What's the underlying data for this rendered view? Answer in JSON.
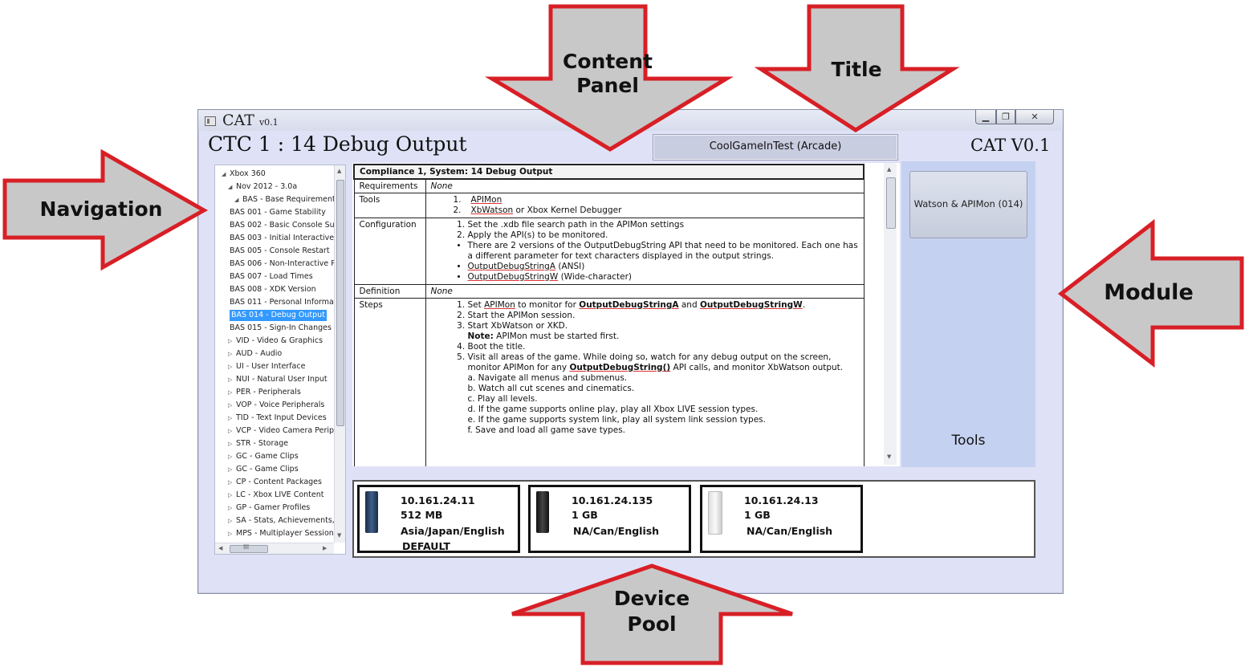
{
  "window": {
    "app_name": "CAT",
    "app_version": "v0.1",
    "page_title": "CTC 1 : 14 Debug Output",
    "game_title": "CoolGameInTest (Arcade)",
    "brand": "CAT V0.1",
    "min_glyph": "▁",
    "max_glyph": "❐",
    "close_glyph": "✕"
  },
  "navigation": {
    "items": [
      {
        "label": "Xbox 360",
        "level": 0,
        "expander": "expanded"
      },
      {
        "label": "Nov 2012 - 3.0a",
        "level": 1,
        "expander": "expanded"
      },
      {
        "label": "BAS - Base Requirements",
        "level": 2,
        "expander": "expanded"
      },
      {
        "label": "BAS 001 - Game Stability",
        "level": 3
      },
      {
        "label": "BAS 002 - Basic Console Sup",
        "level": 3
      },
      {
        "label": "BAS 003 - Initial Interactive S",
        "level": 3
      },
      {
        "label": "BAS 005 - Console Restart",
        "level": 3
      },
      {
        "label": "BAS 006 - Non-Interactive P",
        "level": 3
      },
      {
        "label": "BAS 007 - Load Times",
        "level": 3
      },
      {
        "label": "BAS 008 - XDK Version",
        "level": 3
      },
      {
        "label": "BAS 011 - Personal Informat",
        "level": 3
      },
      {
        "label": "BAS 014 - Debug Output",
        "level": 3,
        "selected": true
      },
      {
        "label": "BAS 015 - Sign-In Changes",
        "level": 3
      },
      {
        "label": "VID - Video & Graphics",
        "level": 2,
        "expander": "collapsed"
      },
      {
        "label": "AUD - Audio",
        "level": 2,
        "expander": "collapsed"
      },
      {
        "label": "UI - User Interface",
        "level": 2,
        "expander": "collapsed"
      },
      {
        "label": "NUI - Natural User Input",
        "level": 2,
        "expander": "collapsed"
      },
      {
        "label": "PER - Peripherals",
        "level": 2,
        "expander": "collapsed"
      },
      {
        "label": "VOP - Voice Peripherals",
        "level": 2,
        "expander": "collapsed"
      },
      {
        "label": "TID - Text Input Devices",
        "level": 2,
        "expander": "collapsed"
      },
      {
        "label": "VCP - Video Camera Perip",
        "level": 2,
        "expander": "collapsed"
      },
      {
        "label": "STR - Storage",
        "level": 2,
        "expander": "collapsed"
      },
      {
        "label": "GC - Game Clips",
        "level": 2,
        "expander": "collapsed"
      },
      {
        "label": "GC - Game Clips",
        "level": 2,
        "expander": "collapsed"
      },
      {
        "label": "CP - Content Packages",
        "level": 2,
        "expander": "collapsed"
      },
      {
        "label": "LC - Xbox LIVE Content",
        "level": 2,
        "expander": "collapsed"
      },
      {
        "label": "GP - Gamer Profiles",
        "level": 2,
        "expander": "collapsed"
      },
      {
        "label": "SA - Stats, Achievements,",
        "level": 2,
        "expander": "collapsed"
      },
      {
        "label": "MPS - Multiplayer Session",
        "level": 2,
        "expander": "collapsed"
      }
    ],
    "hscroll_grip": "III"
  },
  "content": {
    "header": "Compliance 1, System: 14 Debug Output",
    "requirements_label": "Requirements",
    "requirements_value": "None",
    "tools_label": "Tools",
    "tools": [
      {
        "num": "1.",
        "text": "APIMon"
      },
      {
        "num": "2.",
        "pre": "XbWatson",
        "text": " or Xbox Kernel Debugger"
      }
    ],
    "configuration_label": "Configuration",
    "config_1": "Set the .xdb file search path in the APIMon settings",
    "config_2": "Apply the API(s) to be monitored.",
    "config_bullet_1": "There are 2 versions of the OutputDebugString API that need to be monitored. Each one has a different parameter for text characters displayed in the output strings.",
    "config_bullet_2a": "OutputDebugStringA",
    "config_bullet_2b": " (ANSI)",
    "config_bullet_3a": "OutputDebugStringW",
    "config_bullet_3b": " (Wide-character)",
    "definition_label": "Definition",
    "definition_value": "None",
    "steps_label": "Steps",
    "step_1a": "Set ",
    "step_1b": "APIMon",
    "step_1c": " to monitor for ",
    "step_1d": "OutputDebugStringA",
    "step_1e": " and ",
    "step_1f": "OutputDebugStringW",
    "step_1g": ".",
    "step_2": "Start the APIMon session.",
    "step_3": "Start XbWatson or XKD.",
    "step_3_note_label": "Note:",
    "step_3_note": " APIMon must be started first.",
    "step_4": "Boot the title.",
    "step_5a": "Visit all areas of the game. While doing so, watch for any debug output on the screen, monitor APIMon for any ",
    "step_5b": "OutputDebugString()",
    "step_5c": " API calls, and monitor XbWatson output.",
    "step_5_a": "a. Navigate all menus and submenus.",
    "step_5_b": "b. Watch all cut scenes and cinematics.",
    "step_5_c": "c. Play all levels.",
    "step_5_d": "d. If the game supports online play, play all Xbox LIVE session types.",
    "step_5_e": "e. If the game supports system link, play all system link session types.",
    "step_5_f": "f. Save and load all game save types."
  },
  "module": {
    "button_label": "Watson & APIMon (014)",
    "tools_label": "Tools"
  },
  "devices": [
    {
      "ip": "10.161.24.11",
      "memory": "512 MB",
      "region": "Asia/Japan/English",
      "tag": "DEFAULT",
      "color": "blue"
    },
    {
      "ip": "10.161.24.135",
      "memory": "1 GB",
      "region": "NA/Can/English",
      "tag": "",
      "color": "black"
    },
    {
      "ip": "10.161.24.13",
      "memory": "1 GB",
      "region": "NA/Can/English",
      "tag": "",
      "color": "white"
    }
  ],
  "annotations": {
    "content_panel": [
      "Content",
      "Panel"
    ],
    "title": "Title",
    "navigation": "Navigation",
    "module": "Module",
    "device_pool": [
      "Device",
      "Pool"
    ],
    "arrow_fill": "#c8c8c8",
    "arrow_stroke": "#d81f26"
  }
}
